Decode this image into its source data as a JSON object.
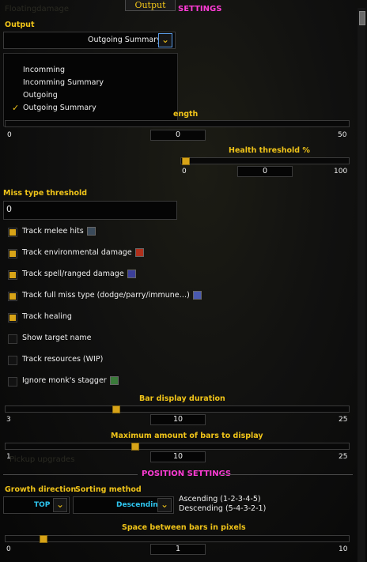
{
  "window": {
    "title": "Output"
  },
  "sections": {
    "settings": "SETTINGS",
    "position_settings": "POSITION SETTINGS"
  },
  "background_text": {
    "top": "Floatingdamage",
    "bottom": "Pickup upgrades"
  },
  "output": {
    "label": "Output",
    "selected": "Outgoing Summary",
    "options": [
      "Incomming",
      "Incomming Summary",
      "Outgoing",
      "Outgoing Summary"
    ],
    "checked_index": 3
  },
  "length_slider": {
    "label": "ength",
    "min": "0",
    "max": "50",
    "value": "0",
    "fraction": 0.0
  },
  "health_threshold": {
    "label": "Health threshold %",
    "min": "0",
    "max": "100",
    "value": "0",
    "fraction": 0.0
  },
  "miss_type_threshold": {
    "label": "Miss type threshold",
    "value": "0"
  },
  "checkboxes": [
    {
      "label": "Track melee hits",
      "checked": true,
      "icon": "sword-icon"
    },
    {
      "label": "Track environmental damage",
      "checked": true,
      "icon": "fire-icon"
    },
    {
      "label": "Track spell/ranged damage",
      "checked": true,
      "icon": "arcane-icon"
    },
    {
      "label": "Track full miss type (dodge/parry/immune…)",
      "checked": true,
      "icon": "shadow-strike-icon"
    },
    {
      "label": "Track healing",
      "checked": true,
      "icon": ""
    },
    {
      "label": "Show target name",
      "checked": false,
      "icon": ""
    },
    {
      "label": "Track resources (WIP)",
      "checked": false,
      "icon": ""
    },
    {
      "label": "Ignore monk's stagger",
      "checked": false,
      "icon": "stagger-icon"
    }
  ],
  "bar_display_duration": {
    "label": "Bar display duration",
    "min": "3",
    "max": "25",
    "value": "10",
    "fraction": 0.318
  },
  "max_bars": {
    "label": "Maximum amount of bars to display",
    "min": "1",
    "max": "25",
    "value": "10",
    "fraction": 0.375
  },
  "position": {
    "growth_direction": {
      "label": "Growth direction",
      "value": "TOP"
    },
    "sorting_method": {
      "label": "Sorting method",
      "value": "Descending"
    },
    "ascending_hint": "Ascending (1-2-3-4-5)",
    "descending_hint": "Descending (5-4-3-2-1)"
  },
  "space_between_bars": {
    "label": "Space between bars in pixels",
    "min": "0",
    "max": "10",
    "value": "1",
    "fraction": 0.1
  },
  "colors": {
    "accent_gold": "#f0c419",
    "header_magenta": "#ff3cd6",
    "value_cyan": "#2ec6f0"
  }
}
